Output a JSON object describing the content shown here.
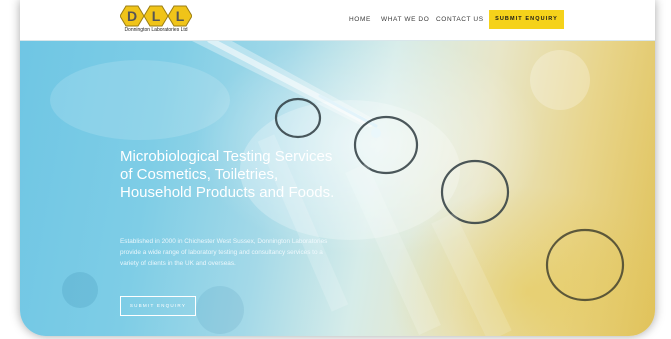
{
  "logo": {
    "letters": [
      "D",
      "L",
      "L"
    ],
    "subtitle": "Donnington Laboratories Ltd",
    "icon": "hexagon-letters-logo"
  },
  "nav": {
    "items": [
      "HOME",
      "WHAT WE DO",
      "CONTACT US"
    ],
    "cta_label": "SUBMIT ENQUIRY"
  },
  "hero": {
    "headline": "Microbiological Testing Services of Cosmetics, Toiletries, Household Products and Foods.",
    "description": "Established in 2000 in Chichester West Sussex, Donnington Laboratories provide a wide range of laboratory testing and consultancy services to a variety of clients in the UK and overseas.",
    "button_label": "SUBMIT ENQUIRY",
    "image": "laboratory-pipette-and-test-tubes"
  },
  "colors": {
    "accent": "#f5d21a",
    "hero_blue": "#6fc6e4",
    "hero_gold": "#e0c25a",
    "text_white": "#ffffff"
  }
}
